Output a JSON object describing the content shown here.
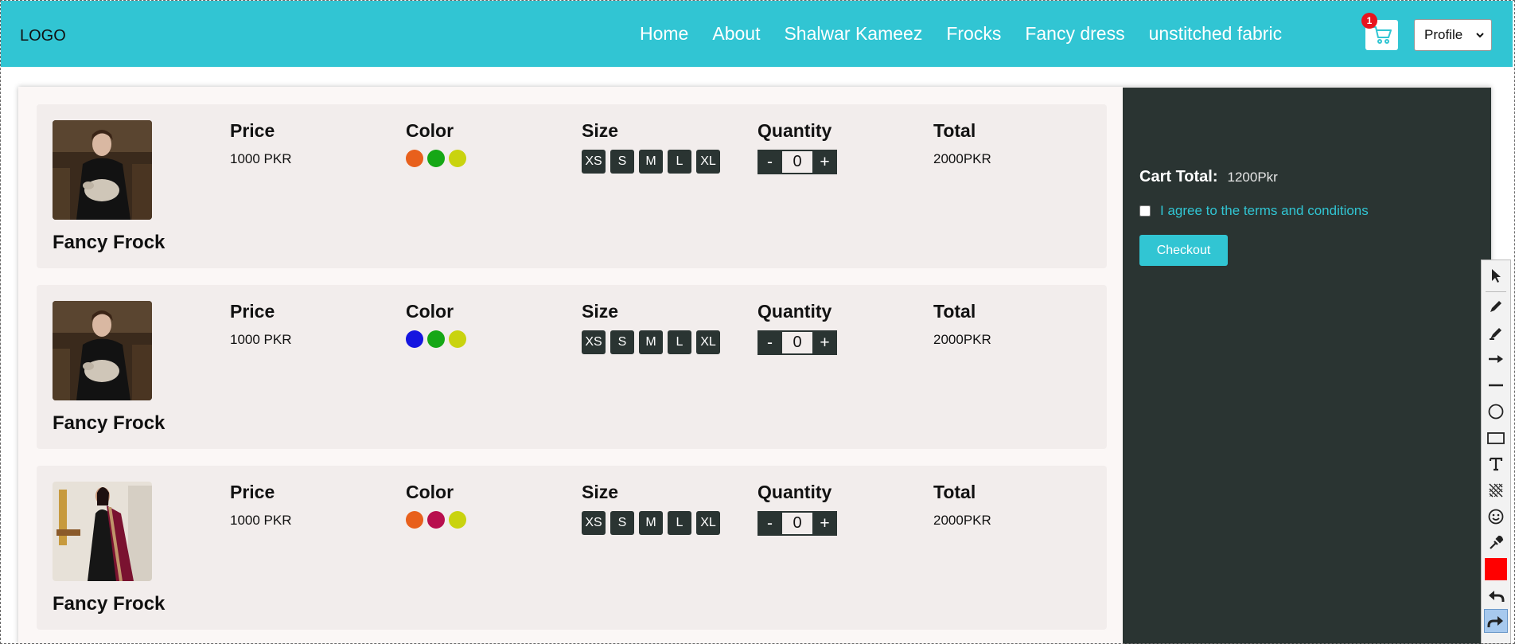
{
  "navbar": {
    "logo": "LOGO",
    "links": [
      "Home",
      "About",
      "Shalwar Kameez",
      "Frocks",
      "Fancy dress",
      "unstitched fabric"
    ],
    "cart_count": "1",
    "profile": "Profile",
    "background_color": "#31c5d3"
  },
  "cart_items": [
    {
      "name": "Fancy Frock",
      "image_icon": "woman-holding-rabbit-photo",
      "price_label": "Price",
      "price": "1000 PKR",
      "color_label": "Color",
      "colors": [
        "#e8601c",
        "#16a716",
        "#c9d30f"
      ],
      "size_label": "Size",
      "sizes": [
        "XS",
        "S",
        "M",
        "L",
        "XL"
      ],
      "quantity_label": "Quantity",
      "quantity": "0",
      "total_label": "Total",
      "total": "2000PKR"
    },
    {
      "name": "Fancy Frock",
      "image_icon": "woman-holding-rabbit-photo",
      "price_label": "Price",
      "price": "1000 PKR",
      "color_label": "Color",
      "colors": [
        "#1515e0",
        "#16a716",
        "#c9d30f"
      ],
      "size_label": "Size",
      "sizes": [
        "XS",
        "S",
        "M",
        "L",
        "XL"
      ],
      "quantity_label": "Quantity",
      "quantity": "0",
      "total_label": "Total",
      "total": "2000PKR"
    },
    {
      "name": "Fancy Frock",
      "image_icon": "black-gown-with-maroon-dupatta-photo",
      "price_label": "Price",
      "price": "1000 PKR",
      "color_label": "Color",
      "colors": [
        "#e8601c",
        "#b80f4e",
        "#c9d30f"
      ],
      "size_label": "Size",
      "sizes": [
        "XS",
        "S",
        "M",
        "L",
        "XL"
      ],
      "quantity_label": "Quantity",
      "quantity": "0",
      "total_label": "Total",
      "total": "2000PKR"
    }
  ],
  "quantity_controls": {
    "decrease": "-",
    "increase": "+"
  },
  "summary": {
    "cart_total_label": "Cart Total:",
    "cart_total_value": "1200Pkr",
    "terms_text": "I agree to the terms and conditions",
    "terms_checked": false,
    "checkout_label": "Checkout",
    "background_color": "#2a3432"
  },
  "annotation_toolbar": {
    "tools": [
      "select-arrow-icon",
      "pen-icon",
      "highlighter-icon",
      "arrow-line-icon",
      "line-icon",
      "ellipse-icon",
      "rectangle-icon",
      "text-icon",
      "blur-icon",
      "emoji-icon",
      "color-picker-icon",
      "color-swatch-icon",
      "undo-icon",
      "redo-icon"
    ],
    "active_tool": "redo-icon",
    "swatch_color": "#ff0000"
  }
}
